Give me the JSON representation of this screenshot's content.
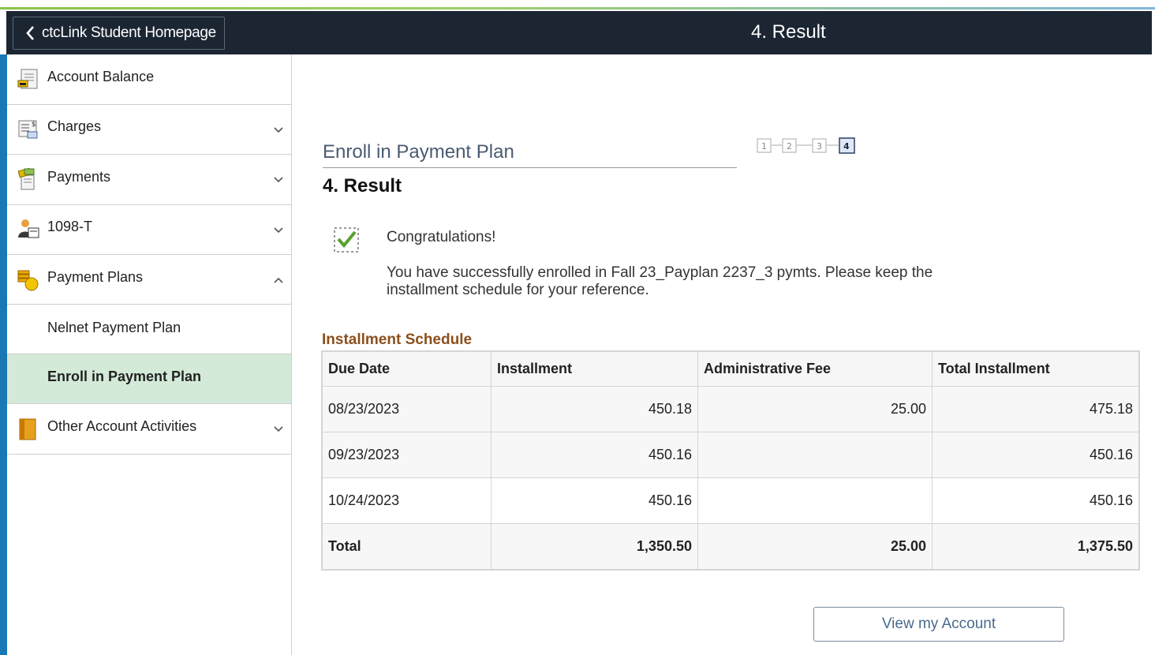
{
  "header": {
    "back_label": "ctcLink Student Homepage",
    "title": "4. Result"
  },
  "sidebar": {
    "items": [
      {
        "label": "Account Balance",
        "icon": "account-balance-icon"
      },
      {
        "label": "Charges",
        "icon": "charges-icon",
        "expanded": false
      },
      {
        "label": "Payments",
        "icon": "payments-icon",
        "expanded": false
      },
      {
        "label": "1098-T",
        "icon": "tax-form-icon",
        "expanded": false
      },
      {
        "label": "Payment Plans",
        "icon": "payment-plans-icon",
        "expanded": true
      },
      {
        "label": "Nelnet Payment Plan"
      },
      {
        "label": "Enroll in Payment Plan",
        "active": true
      },
      {
        "label": "Other Account Activities",
        "icon": "other-activities-icon",
        "expanded": false
      }
    ]
  },
  "main": {
    "plan_title": "Enroll in Payment Plan",
    "steps": [
      "1",
      "2",
      "3",
      "4"
    ],
    "current_step": 4,
    "step_title": "4. Result",
    "congrats": "Congratulations!",
    "message": "You have successfully enrolled in Fall 23_Payplan 2237_3 pymts.  Please keep the installment schedule for your reference.",
    "schedule_title": "Installment Schedule",
    "table": {
      "columns": [
        "Due Date",
        "Installment",
        "Administrative Fee",
        "Total Installment"
      ],
      "rows": [
        [
          "08/23/2023",
          "450.18",
          "25.00",
          "475.18"
        ],
        [
          "09/23/2023",
          "450.16",
          "",
          "450.16"
        ],
        [
          "10/24/2023",
          "450.16",
          "",
          "450.16"
        ]
      ],
      "total": [
        "Total",
        "1,350.50",
        "25.00",
        "1,375.50"
      ]
    },
    "view_button": "View my Account"
  },
  "colors": {
    "header_bg": "#1c2633",
    "active_item_bg": "#d4ead9",
    "schedule_title": "#8b4f1c",
    "plan_title": "#4b5a70"
  }
}
